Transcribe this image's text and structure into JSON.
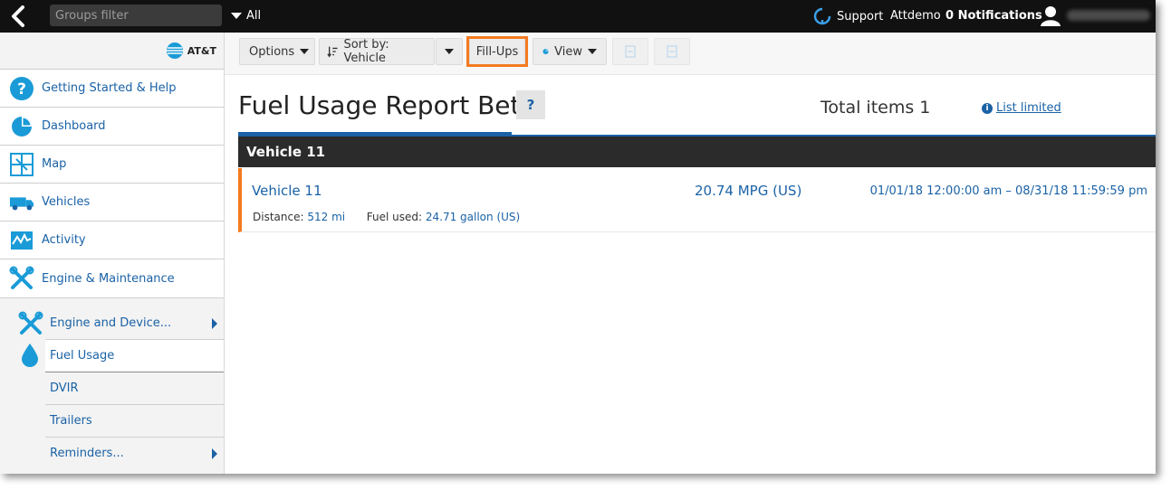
{
  "topbar": {
    "groups_filter_placeholder": "Groups filter",
    "all_label": "All",
    "support_label": "Support",
    "user_label": "Attdemo",
    "notifications_label": "0 Notifications"
  },
  "sidebar": {
    "brand": "AT&T",
    "items": [
      {
        "label": "Getting Started & Help",
        "icon": "help-icon"
      },
      {
        "label": "Dashboard",
        "icon": "pie-chart-icon"
      },
      {
        "label": "Map",
        "icon": "map-icon"
      },
      {
        "label": "Vehicles",
        "icon": "truck-icon"
      },
      {
        "label": "Activity",
        "icon": "activity-icon"
      },
      {
        "label": "Engine & Maintenance",
        "icon": "wrench-icon"
      }
    ],
    "subitems": [
      {
        "label": "Engine and Device..."
      },
      {
        "label": "Fuel Usage"
      },
      {
        "label": "DVIR"
      },
      {
        "label": "Trailers"
      },
      {
        "label": "Reminders..."
      }
    ]
  },
  "toolbar": {
    "options_label": "Options",
    "sort_label": "Sort by: Vehicle",
    "fillups_label": "Fill-Ups",
    "view_label": "View"
  },
  "report": {
    "title": "Fuel Usage Report Beta",
    "help_label": "?",
    "total_items": "Total items 1",
    "list_limited": "List limited",
    "group_header": "Vehicle 11",
    "rows": [
      {
        "name": "Vehicle 11",
        "mpg": "20.74 MPG (US)",
        "dates": "01/01/18 12:00:00 am – 08/31/18 11:59:59 pm",
        "distance_label": "Distance:",
        "distance_value": "512 mi",
        "fuel_label": "Fuel used:",
        "fuel_value": "24.71 gallon (US)"
      }
    ]
  },
  "colors": {
    "accent_blue": "#1a62a6",
    "highlight_orange": "#f47a20",
    "topbar_bg": "#111111"
  }
}
